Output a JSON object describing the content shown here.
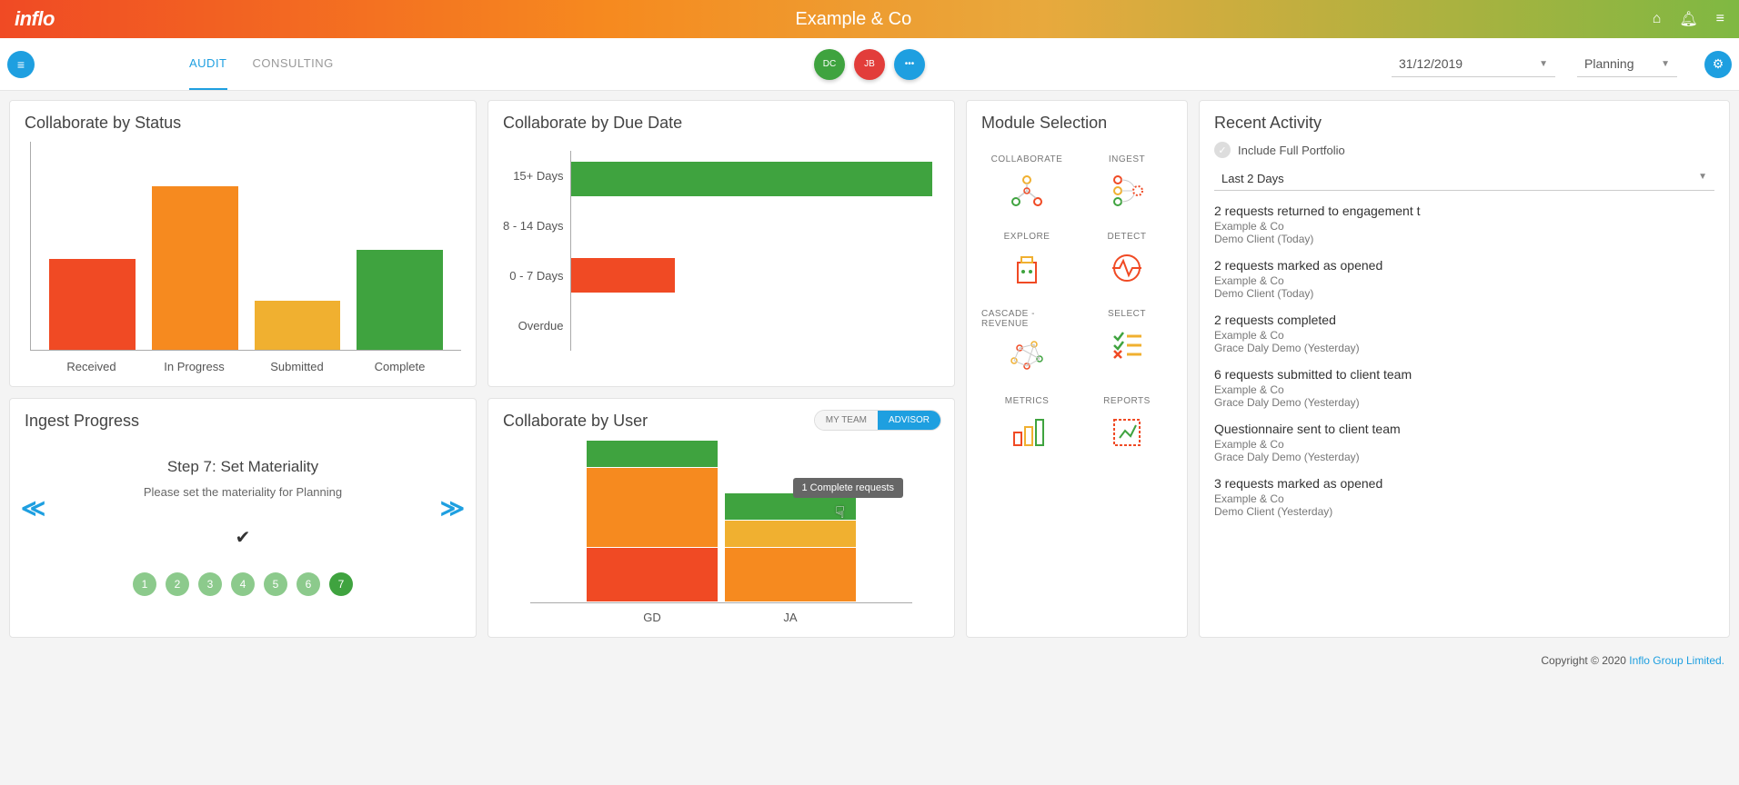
{
  "header": {
    "logo": "inflo",
    "title": "Example & Co"
  },
  "toolbar": {
    "tabs": [
      "AUDIT",
      "CONSULTING"
    ],
    "active_tab": 0,
    "avatars": [
      {
        "initials": "DC",
        "color": "av-green"
      },
      {
        "initials": "JB",
        "color": "av-red"
      },
      {
        "initials": "•••",
        "color": "av-blue"
      }
    ],
    "date": "31/12/2019",
    "phase": "Planning"
  },
  "status": {
    "title": "Collaborate by Status",
    "categories": [
      "Received",
      "In Progress",
      "Submitted",
      "Complete"
    ]
  },
  "due": {
    "title": "Collaborate by Due Date",
    "categories": [
      "15+ Days",
      "8 - 14 Days",
      "0 - 7 Days",
      "Overdue"
    ]
  },
  "ingest": {
    "title": "Ingest Progress",
    "step_title": "Step 7: Set Materiality",
    "step_sub": "Please set the materiality for Planning",
    "steps": [
      "1",
      "2",
      "3",
      "4",
      "5",
      "6",
      "7"
    ],
    "active_step": 6
  },
  "user": {
    "title": "Collaborate by User",
    "toggle": [
      "MY TEAM",
      "ADVISOR"
    ],
    "active_toggle": 1,
    "categories": [
      "GD",
      "JA"
    ],
    "tooltip": "1 Complete requests"
  },
  "modules": {
    "title": "Module Selection",
    "items": [
      "COLLABORATE",
      "INGEST",
      "EXPLORE",
      "DETECT",
      "CASCADE - REVENUE",
      "SELECT",
      "METRICS",
      "REPORTS"
    ]
  },
  "activity": {
    "title": "Recent Activity",
    "include_label": "Include Full Portfolio",
    "range": "Last 2 Days",
    "items": [
      {
        "t": "2 requests returned to engagement t",
        "c": "Example & Co",
        "d": "Demo Client (Today)"
      },
      {
        "t": "2 requests marked as opened",
        "c": "Example & Co",
        "d": "Demo Client (Today)"
      },
      {
        "t": "2 requests completed",
        "c": "Example & Co",
        "d": "Grace Daly Demo (Yesterday)"
      },
      {
        "t": "6 requests submitted to client team",
        "c": "Example & Co",
        "d": "Grace Daly Demo (Yesterday)"
      },
      {
        "t": "Questionnaire sent to client team",
        "c": "Example & Co",
        "d": "Grace Daly Demo (Yesterday)"
      },
      {
        "t": "3 requests marked as opened",
        "c": "Example & Co",
        "d": "Demo Client (Yesterday)"
      }
    ]
  },
  "footer": {
    "copyright": "Copyright © 2020 ",
    "link": "Inflo Group Limited."
  },
  "chart_data": [
    {
      "type": "bar",
      "title": "Collaborate by Status",
      "categories": [
        "Received",
        "In Progress",
        "Submitted",
        "Complete"
      ],
      "values": [
        4,
        7,
        2,
        4
      ],
      "colors": [
        "#f04a24",
        "#f68a1f",
        "#f0b030",
        "#3fa33f"
      ]
    },
    {
      "type": "bar",
      "orientation": "horizontal",
      "title": "Collaborate by Due Date",
      "categories": [
        "15+ Days",
        "8 - 14 Days",
        "0 - 7 Days",
        "Overdue"
      ],
      "values": [
        14,
        0,
        4,
        0
      ],
      "colors": [
        "#3fa33f",
        "",
        "#f04a24",
        ""
      ]
    },
    {
      "type": "bar",
      "stacked": true,
      "title": "Collaborate by User",
      "categories": [
        "GD",
        "JA"
      ],
      "series": [
        {
          "name": "Complete",
          "values": [
            1,
            1
          ],
          "color": "#3fa33f"
        },
        {
          "name": "Submitted",
          "values": [
            0,
            1
          ],
          "color": "#f0b030"
        },
        {
          "name": "In Progress",
          "values": [
            3,
            2
          ],
          "color": "#f68a1f"
        },
        {
          "name": "Received",
          "values": [
            2,
            0
          ],
          "color": "#f04a24"
        }
      ]
    }
  ]
}
